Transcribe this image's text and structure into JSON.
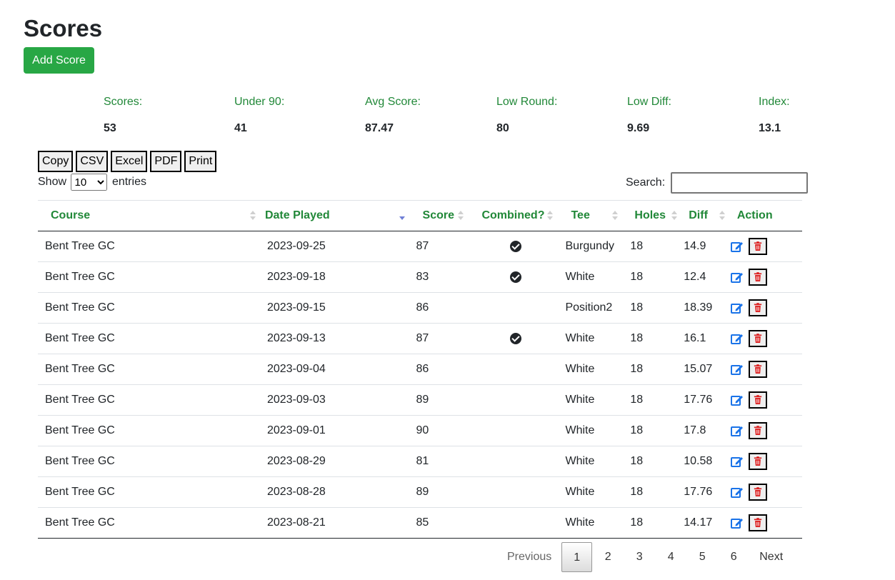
{
  "page": {
    "title": "Scores",
    "add_button": "Add Score"
  },
  "stats": [
    {
      "label": "Scores:",
      "value": "53"
    },
    {
      "label": "Under 90:",
      "value": "41"
    },
    {
      "label": "Avg Score:",
      "value": "87.47"
    },
    {
      "label": "Low Round:",
      "value": "80"
    },
    {
      "label": "Low Diff:",
      "value": "9.69"
    },
    {
      "label": "Index:",
      "value": "13.1"
    }
  ],
  "export_buttons": [
    "Copy",
    "CSV",
    "Excel",
    "PDF",
    "Print"
  ],
  "length": {
    "show": "Show",
    "selected": "10",
    "entries": "entries"
  },
  "search": {
    "label": "Search:",
    "value": ""
  },
  "table": {
    "columns": [
      "Course",
      "Date Played",
      "Score",
      "Combined?",
      "Tee",
      "Holes",
      "Diff",
      "Action"
    ],
    "sorted_column": "Date Played",
    "sort_direction": "desc",
    "rows": [
      {
        "course": "Bent Tree GC",
        "date": "2023-09-25",
        "score": "87",
        "combined": true,
        "tee": "Burgundy",
        "holes": "18",
        "diff": "14.9"
      },
      {
        "course": "Bent Tree GC",
        "date": "2023-09-18",
        "score": "83",
        "combined": true,
        "tee": "White",
        "holes": "18",
        "diff": "12.4"
      },
      {
        "course": "Bent Tree GC",
        "date": "2023-09-15",
        "score": "86",
        "combined": false,
        "tee": "Position2",
        "holes": "18",
        "diff": "18.39"
      },
      {
        "course": "Bent Tree GC",
        "date": "2023-09-13",
        "score": "87",
        "combined": true,
        "tee": "White",
        "holes": "18",
        "diff": "16.1"
      },
      {
        "course": "Bent Tree GC",
        "date": "2023-09-04",
        "score": "86",
        "combined": false,
        "tee": "White",
        "holes": "18",
        "diff": "15.07"
      },
      {
        "course": "Bent Tree GC",
        "date": "2023-09-03",
        "score": "89",
        "combined": false,
        "tee": "White",
        "holes": "18",
        "diff": "17.76"
      },
      {
        "course": "Bent Tree GC",
        "date": "2023-09-01",
        "score": "90",
        "combined": false,
        "tee": "White",
        "holes": "18",
        "diff": "17.8"
      },
      {
        "course": "Bent Tree GC",
        "date": "2023-08-29",
        "score": "81",
        "combined": false,
        "tee": "White",
        "holes": "18",
        "diff": "10.58"
      },
      {
        "course": "Bent Tree GC",
        "date": "2023-08-28",
        "score": "89",
        "combined": false,
        "tee": "White",
        "holes": "18",
        "diff": "17.76"
      },
      {
        "course": "Bent Tree GC",
        "date": "2023-08-21",
        "score": "85",
        "combined": false,
        "tee": "White",
        "holes": "18",
        "diff": "14.17"
      }
    ],
    "icons": {
      "edit": "edit-icon",
      "delete": "trash-icon",
      "combined": "check-circle-icon"
    }
  },
  "pagination": {
    "previous": "Previous",
    "pages": [
      "1",
      "2",
      "3",
      "4",
      "5",
      "6"
    ],
    "current": "1",
    "next": "Next"
  },
  "colors": {
    "header_green": "#218838",
    "button_green": "#28a745",
    "edit_blue": "#1a73e8",
    "delete_red": "#dc1e1e"
  }
}
